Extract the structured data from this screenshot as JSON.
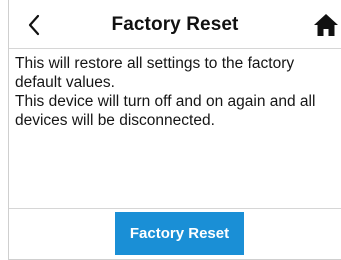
{
  "header": {
    "title": "Factory Reset",
    "back_icon": "chevron-left-icon",
    "home_icon": "home-icon"
  },
  "content": {
    "line1": "This will restore all settings to the factory default values.",
    "line2": "This device will turn off and on again and all devices will be disconnected."
  },
  "footer": {
    "reset_label": "Factory Reset"
  },
  "colors": {
    "accent": "#1a8fd6",
    "text": "#111111",
    "divider": "#d6d6d6"
  }
}
